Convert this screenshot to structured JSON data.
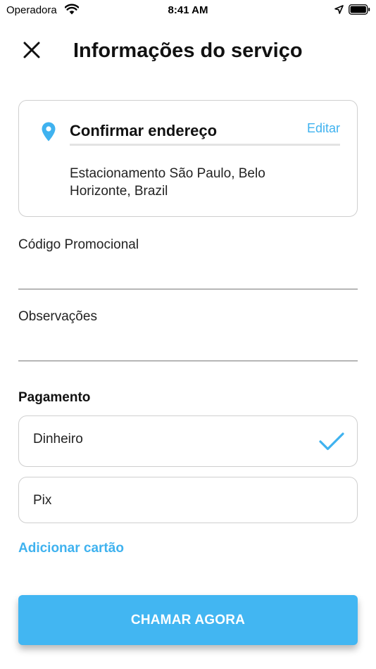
{
  "status_bar": {
    "carrier": "Operadora",
    "time": "8:41 AM"
  },
  "header": {
    "title": "Informações do serviço",
    "close_icon": "close-icon"
  },
  "address_card": {
    "heading": "Confirmar endereço",
    "edit_label": "Editar",
    "address": "Estacionamento São Paulo, Belo Horizonte, Brazil",
    "icon": "location-pin-icon"
  },
  "form": {
    "promo_label": "Código Promocional",
    "promo_value": "",
    "notes_label": "Observações",
    "notes_value": ""
  },
  "payment": {
    "title": "Pagamento",
    "options": [
      {
        "label": "Dinheiro",
        "selected": true
      },
      {
        "label": "Pix",
        "selected": false
      }
    ],
    "add_card_label": "Adicionar cartão"
  },
  "action": {
    "label": "CHAMAR AGORA"
  },
  "colors": {
    "accent": "#3fb2ef",
    "button": "#42b6f2",
    "border": "#cfcfcf",
    "text": "#111111"
  }
}
